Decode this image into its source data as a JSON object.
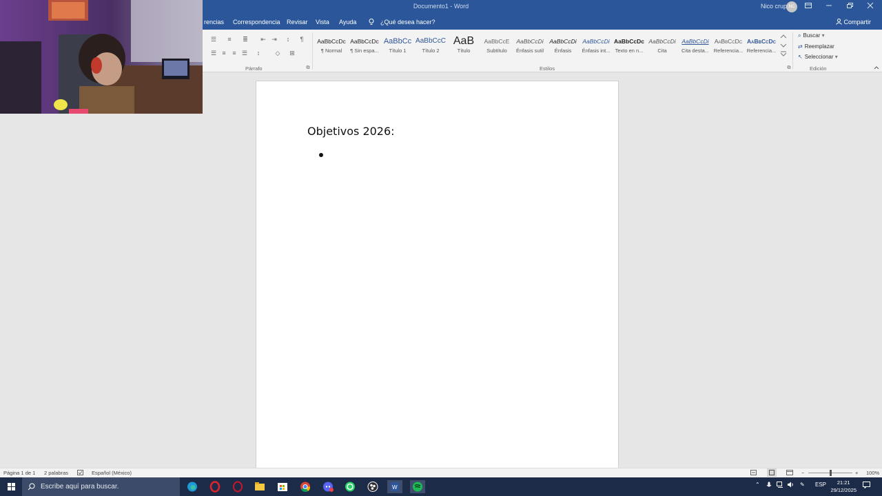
{
  "window": {
    "doc_title": "Documento1 - Word",
    "user_name": "Nico crupi",
    "user_initials": "NC"
  },
  "tabs": [
    "rencias",
    "Correspondencia",
    "Revisar",
    "Vista",
    "Ayuda"
  ],
  "tell_me": "¿Qué desea hacer?",
  "share_label": "Compartir",
  "ribbon": {
    "paragraph_label": "Párrafo",
    "styles_label": "Estilos",
    "editing_label": "Edición",
    "styles": [
      {
        "sample": "AaBbCcDc",
        "name": "¶ Normal"
      },
      {
        "sample": "AaBbCcDc",
        "name": "¶ Sin espa..."
      },
      {
        "sample": "AaBbCc",
        "name": "Título 1"
      },
      {
        "sample": "AaBbCcC",
        "name": "Título 2"
      },
      {
        "sample": "AaB",
        "name": "Título"
      },
      {
        "sample": "AaBbCcE",
        "name": "Subtítulo"
      },
      {
        "sample": "AaBbCcDi",
        "name": "Énfasis sutil"
      },
      {
        "sample": "AaBbCcDi",
        "name": "Énfasis"
      },
      {
        "sample": "AaBbCcDi",
        "name": "Énfasis int..."
      },
      {
        "sample": "AaBbCcDc",
        "name": "Texto en n..."
      },
      {
        "sample": "AaBbCcDi",
        "name": "Cita"
      },
      {
        "sample": "AaBbCcDi",
        "name": "Cita desta..."
      },
      {
        "sample": "AaBbCcDc",
        "name": "Referencia..."
      },
      {
        "sample": "AaBbCcDc",
        "name": "Referencia..."
      }
    ],
    "editing": {
      "find": "Buscar",
      "replace": "Reemplazar",
      "select": "Seleccionar"
    }
  },
  "document": {
    "heading": "Objetivos 2026:"
  },
  "status": {
    "page": "Página 1 de 1",
    "words": "2 palabras",
    "language": "Español (México)",
    "zoom": "100%"
  },
  "taskbar": {
    "search_placeholder": "Escribe aquí para buscar.",
    "lang": "ESP",
    "time": "21:21",
    "date": "29/12/2025"
  }
}
